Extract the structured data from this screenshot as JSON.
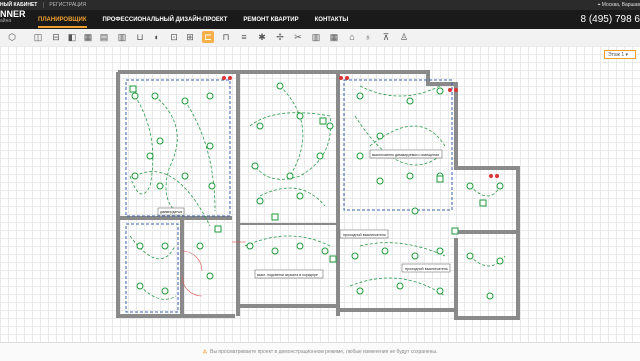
{
  "topbar": {
    "cabinet_label": "НЫЙ КАБИНЕТ",
    "register_label": "РЕГИСТРАЦИЯ",
    "location": "Москва, Варшав"
  },
  "logo": {
    "line1": "NNER",
    "line2": "айна"
  },
  "nav": {
    "items": [
      {
        "label": "ПЛАНИРОВЩИК",
        "active": true
      },
      {
        "label": "ПРОФЕССИОНАЛЬНЫЙ ДИЗАЙН-ПРОЕКТ",
        "active": false
      },
      {
        "label": "РЕМОНТ КВАРТИР",
        "active": false
      },
      {
        "label": "КОНТАКТЫ",
        "active": false
      }
    ],
    "phone": "8 (495) 798 6"
  },
  "toolbar": {
    "icons": [
      "cube-icon",
      "wall-icon",
      "door-icon",
      "window-icon",
      "stairs-icon",
      "column-icon",
      "sink-icon",
      "bath-icon",
      "toilet-icon",
      "shower-icon",
      "socket-icon",
      "electric-icon",
      "light-icon",
      "switch-icon",
      "fan-icon",
      "snowflake-icon",
      "heater-icon",
      "radiator-icon",
      "tiles-icon",
      "door-frame-icon",
      "lamp-icon",
      "chandelier-icon",
      "user-icon"
    ],
    "active_index": 10
  },
  "floor_selector": {
    "label": "Этаж 1 ▾"
  },
  "plan": {
    "labels": {
      "switch_pass_1": "проходной выключатель",
      "switch_pass_2": "проходной выключатель",
      "switch_dimmer": "выключатель диммируемого освещения",
      "mirror_light": "выкл. подсветки зеркала в коридоре",
      "dimmer_small": "диммер/датчик"
    }
  },
  "status": {
    "warning_icon": "warning-icon",
    "text": "Вы просматриваете проект в демонстрационном режиме, любые изменения не будут сохранены."
  },
  "colors": {
    "accent": "#f0a030",
    "nav_bg": "#1a1a1a",
    "wall": "#8a8a8a",
    "wiring": "#2a9a4a",
    "fixture": "#1e9a3c"
  }
}
